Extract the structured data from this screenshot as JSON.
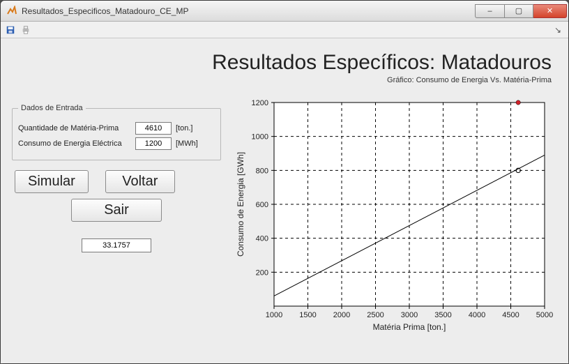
{
  "window": {
    "title": "Resultados_Especificos_Matadouro_CE_MP",
    "buttons": {
      "min": "–",
      "max": "▢",
      "close": "✕"
    }
  },
  "toolbar": {
    "save_name": "save-icon",
    "print_name": "print-icon",
    "dock_name": "dock-arrow-icon"
  },
  "header": {
    "title": "Resultados Específicos: Matadouros",
    "subtitle": "Gráfico: Consumo de Energia Vs. Matéria-Prima"
  },
  "inputs": {
    "legend": "Dados de Entrada",
    "mp_label": "Quantidade de Matéria-Prima",
    "mp_value": "4610",
    "mp_unit": "[ton.]",
    "ce_label": "Consumo de Energia Eléctrica",
    "ce_value": "1200",
    "ce_unit": "[MWh]"
  },
  "buttons": {
    "simular": "Simular",
    "voltar": "Voltar",
    "sair": "Sair"
  },
  "result": {
    "value": "33.1757"
  },
  "chart_data": {
    "type": "line",
    "title": "",
    "xlabel": "Matéria Prima [ton.]",
    "ylabel": "Consumo de Energia [GWh]",
    "xlim": [
      1000,
      5000
    ],
    "ylim": [
      0,
      1200
    ],
    "xticks": [
      1000,
      1500,
      2000,
      2500,
      3000,
      3500,
      4000,
      4500,
      5000
    ],
    "yticks": [
      200,
      400,
      600,
      800,
      1000,
      1200
    ],
    "series": [
      {
        "name": "trend",
        "style": "line",
        "x": [
          1000,
          5000
        ],
        "y": [
          60,
          890
        ]
      }
    ],
    "points": [
      {
        "name": "expected",
        "x": 4610,
        "y": 800,
        "marker": "circle-open"
      },
      {
        "name": "input",
        "x": 4610,
        "y": 1200,
        "marker": "circle-red"
      }
    ]
  }
}
